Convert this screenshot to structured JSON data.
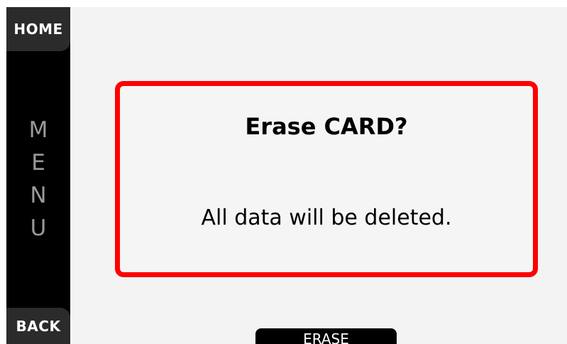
{
  "sidebar": {
    "home_label": "HOME",
    "menu_letters": [
      "M",
      "E",
      "N",
      "U"
    ],
    "back_label": "BACK"
  },
  "dialog": {
    "title": "Erase CARD?",
    "message": "All data will be deleted."
  },
  "actions": {
    "erase_label": "ERASE"
  },
  "colors": {
    "alert_border": "#ff0000",
    "rail": "#000000",
    "side_button": "#2b2b2b",
    "menu_text": "#9a9a9a",
    "background": "#f3f3f3"
  }
}
